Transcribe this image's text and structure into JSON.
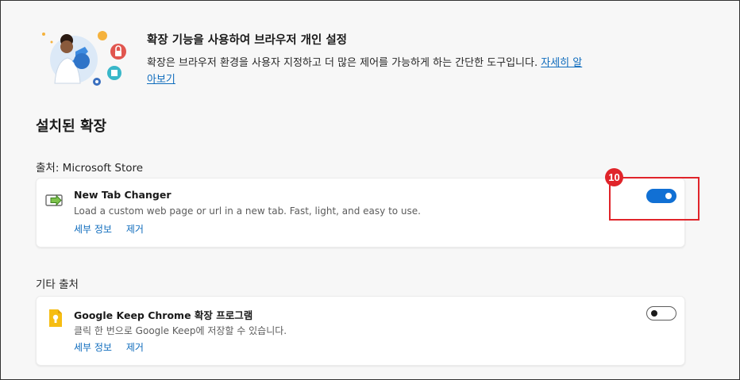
{
  "intro": {
    "title": "확장 기능을 사용하여 브라우저 개인 설정",
    "description": "확장은 브라우저 환경을 사용자 지정하고 더 많은 제어를 가능하게 하는 간단한 도구입니다.",
    "link": "자세히 알아보기"
  },
  "installed": {
    "title": "설치된 확장"
  },
  "sources": [
    {
      "label": "출처: Microsoft Store",
      "extension": {
        "name": "New Tab Changer",
        "description": "Load a custom web page or url in a new tab. Fast, light, and easy to use.",
        "details_link": "세부 정보",
        "remove_link": "제거",
        "enabled": true,
        "icon": "arrow-page-icon"
      }
    },
    {
      "label": "기타 출처",
      "extension": {
        "name": "Google Keep Chrome 확장 프로그램",
        "description": "클릭 한 번으로 Google Keep에 저장할 수 있습니다.",
        "details_link": "세부 정보",
        "remove_link": "제거",
        "enabled": false,
        "icon": "google-keep-icon"
      }
    }
  ],
  "annotation": {
    "step": "10",
    "color": "#e0242a"
  },
  "colors": {
    "accent": "#1170d4",
    "link": "#0f6cbd",
    "background": "#f7f7f7"
  }
}
